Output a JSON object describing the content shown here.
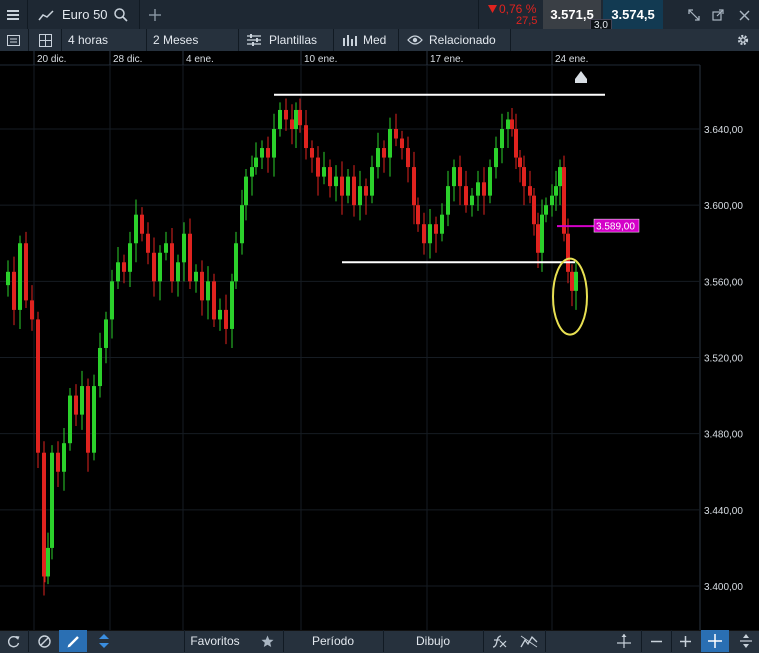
{
  "header": {
    "menu_icon": "hamburger-icon",
    "chart_type_icon": "line-chart-icon",
    "instrument": "Euro 50",
    "search_icon": "search-icon",
    "add_icon": "plus-icon",
    "change_percent": "0,76 %",
    "change_points": "27,5",
    "sell_price": "3.571,5",
    "buy_price": "3.574,5",
    "spread": "3,0"
  },
  "toolbar": {
    "interval": "4 horas",
    "range": "2 Meses",
    "templates": "Plantillas",
    "indicator": "Med",
    "related": "Relacionado"
  },
  "bottom": {
    "favorites": "Favoritos",
    "period": "Período",
    "drawing": "Dibujo"
  },
  "chart_data": {
    "type": "candlestick",
    "x_tick_labels": [
      "20 dic.",
      "28 dic.",
      "4 ene.",
      "10 ene.",
      "17 ene.",
      "24 ene."
    ],
    "y_tick_labels": [
      "3.640,00",
      "3.600,00",
      "3.560,00",
      "3.520,00",
      "3.480,00",
      "3.440,00",
      "3.400,00"
    ],
    "y_ticks": [
      3640,
      3600,
      3560,
      3520,
      3480,
      3440,
      3400
    ],
    "ylim": [
      3380,
      3663
    ],
    "price_marker": {
      "label": "3.589,00",
      "value": 3589,
      "color": "#d400c8"
    },
    "resistance_line": 3658,
    "support_line": 3570,
    "highlight": "circle around latest candles",
    "up_color": "#2bd12b",
    "down_color": "#e0231f",
    "grid": true
  },
  "colors": {
    "accent_sell": "#e0231f",
    "background": "#000000",
    "panel": "#26313d"
  }
}
